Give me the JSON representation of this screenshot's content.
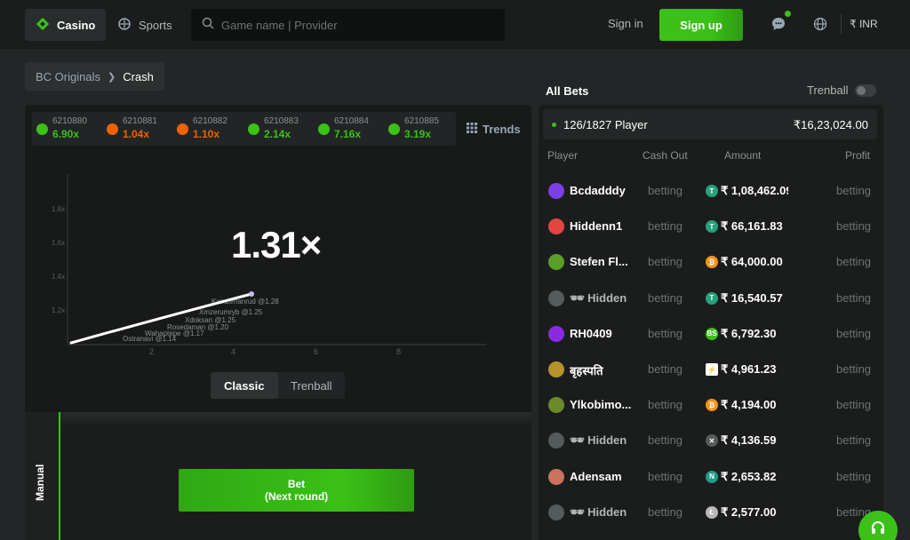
{
  "nav": {
    "casino_label": "Casino",
    "sports_label": "Sports",
    "search_placeholder": "Game name | Provider",
    "signin_label": "Sign in",
    "signup_label": "Sign up",
    "currency_label": "₹ INR"
  },
  "breadcrumb": {
    "home": "BC Originals",
    "current": "Crash"
  },
  "history": [
    {
      "id": "6210880",
      "value": "6.90x",
      "color": "#3bc117"
    },
    {
      "id": "6210881",
      "value": "1.04x",
      "color": "#ed6300"
    },
    {
      "id": "6210882",
      "value": "1.10x",
      "color": "#ed6300"
    },
    {
      "id": "6210883",
      "value": "2.14x",
      "color": "#3bc117"
    },
    {
      "id": "6210884",
      "value": "7.16x",
      "color": "#3bc117"
    },
    {
      "id": "6210885",
      "value": "3.19x",
      "color": "#3bc117"
    }
  ],
  "trends_label": "Trends",
  "game": {
    "multiplier": "1.31×",
    "y_ticks": [
      "1.8x",
      "1.6x",
      "1.4x",
      "1.2x"
    ],
    "x_ticks": [
      "2",
      "4",
      "6",
      "8"
    ],
    "cashout_labels": [
      "Kxmzerfanrud @1.28",
      "Xmzerumryb @1.25",
      "Xdoksan @1.25",
      "Rosedaman @1.20",
      "Wahaptepe @1.17",
      "Ostranavi @1.14"
    ],
    "mode_classic": "Classic",
    "mode_trenball": "Trenball"
  },
  "bet_panel": {
    "manual_label": "Manual",
    "bet_label": "Bet",
    "bet_sublabel": "(Next round)"
  },
  "bets": {
    "title": "All Bets",
    "trenball_label": "Trenball",
    "players_summary": "126/1827 Player",
    "total_amount": "₹16,23,024.00",
    "columns": {
      "player": "Player",
      "cashout": "Cash Out",
      "amount": "Amount",
      "profit": "Profit"
    },
    "rows": [
      {
        "name": "Bcdadddy",
        "cashout": "betting",
        "amount": "₹ 1,08,462.09",
        "profit": "betting",
        "coin": "T",
        "coin_color": "#26a17b",
        "avatar_color": "#7b3fe4"
      },
      {
        "name": "Hiddenn1",
        "cashout": "betting",
        "amount": "₹ 66,161.83",
        "profit": "betting",
        "coin": "T",
        "coin_color": "#26a17b",
        "avatar_color": "#e4453f"
      },
      {
        "name": "Stefen Fl...",
        "cashout": "betting",
        "amount": "₹ 64,000.00",
        "profit": "betting",
        "coin": "₿",
        "coin_color": "#f7931a",
        "avatar_color": "#5a9e2a"
      },
      {
        "name": "Hidden",
        "hidden": true,
        "cashout": "betting",
        "amount": "₹ 16,540.57",
        "profit": "betting",
        "coin": "T",
        "coin_color": "#26a17b",
        "avatar_color": "#555a5a"
      },
      {
        "name": "RH0409",
        "cashout": "betting",
        "amount": "₹ 6,792.30",
        "profit": "betting",
        "coin": "BS",
        "coin_color": "#3bc117",
        "avatar_color": "#8a2be2"
      },
      {
        "name": "बृहस्पति",
        "cashout": "betting",
        "amount": "₹ 4,961.23",
        "profit": "betting",
        "coin": "⚡",
        "coin_color": "#ffffff",
        "avatar_color": "#b5932a"
      },
      {
        "name": "Ylkobimo...",
        "cashout": "betting",
        "amount": "₹ 4,194.00",
        "profit": "betting",
        "coin": "₿",
        "coin_color": "#f7931a",
        "avatar_color": "#6a8a2a"
      },
      {
        "name": "Hidden",
        "hidden": true,
        "cashout": "betting",
        "amount": "₹ 4,136.59",
        "profit": "betting",
        "coin": "✕",
        "coin_color": "#555a5a",
        "avatar_color": "#555a5a"
      },
      {
        "name": "Adensam",
        "cashout": "betting",
        "amount": "₹ 2,653.82",
        "profit": "betting",
        "coin": "N",
        "coin_color": "#1f9e84",
        "avatar_color": "#c9745a"
      },
      {
        "name": "Hidden",
        "hidden": true,
        "cashout": "betting",
        "amount": "₹ 2,577.00",
        "profit": "betting",
        "coin": "Ł",
        "coin_color": "#b8b8b8",
        "avatar_color": "#555a5a"
      }
    ]
  }
}
